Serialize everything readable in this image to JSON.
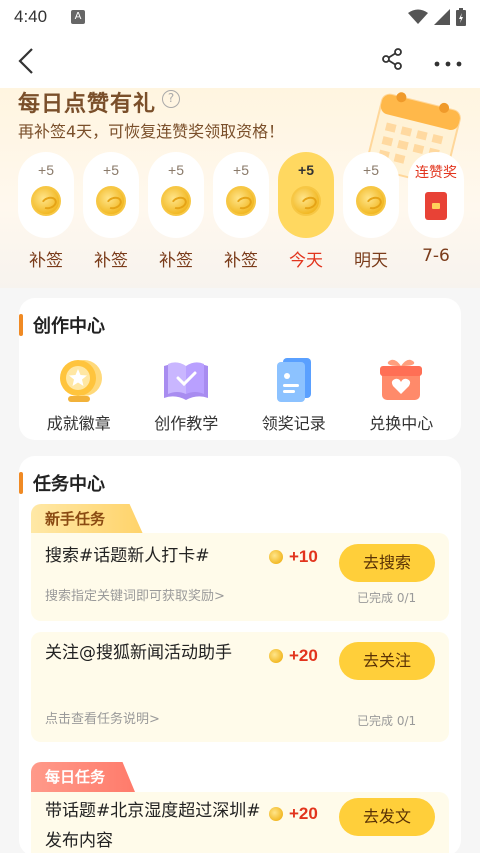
{
  "status": {
    "time": "4:40"
  },
  "signin": {
    "title": "每日点赞有礼",
    "subtitle": "再补签4天，可恢复连赞奖领取资格！",
    "days": [
      {
        "points": "+5",
        "label": "补签"
      },
      {
        "points": "+5",
        "label": "补签"
      },
      {
        "points": "+5",
        "label": "补签"
      },
      {
        "points": "+5",
        "label": "补签"
      },
      {
        "points": "+5",
        "label": "今天"
      },
      {
        "points": "+5",
        "label": "明天"
      },
      {
        "points": "连赞奖",
        "label": "7-6"
      }
    ]
  },
  "creation": {
    "title": "创作中心",
    "items": [
      {
        "label": "成就徽章",
        "icon": "medal-icon"
      },
      {
        "label": "创作教学",
        "icon": "book-icon"
      },
      {
        "label": "领奖记录",
        "icon": "record-icon"
      },
      {
        "label": "兑换中心",
        "icon": "gift-icon"
      }
    ]
  },
  "tasks": {
    "title": "任务中心",
    "newbie_tag": "新手任务",
    "daily_tag": "每日任务",
    "items": [
      {
        "name": "搜索#话题新人打卡#",
        "desc": "搜索指定关键词即可获取奖励>",
        "reward": "+10",
        "button": "去搜索",
        "progress": "已完成 0/1"
      },
      {
        "name": "关注@搜狐新闻活动助手",
        "desc": "点击查看任务说明>",
        "reward": "+20",
        "button": "去关注",
        "progress": "已完成 0/1"
      },
      {
        "name": "带话题#北京湿度超过深圳#发布内容",
        "reward": "+20",
        "button": "去发文"
      }
    ]
  },
  "colors": {
    "accent": "#f08a24",
    "button": "#ffcf3a",
    "reward": "#e2341d",
    "today": "#ffd860"
  }
}
